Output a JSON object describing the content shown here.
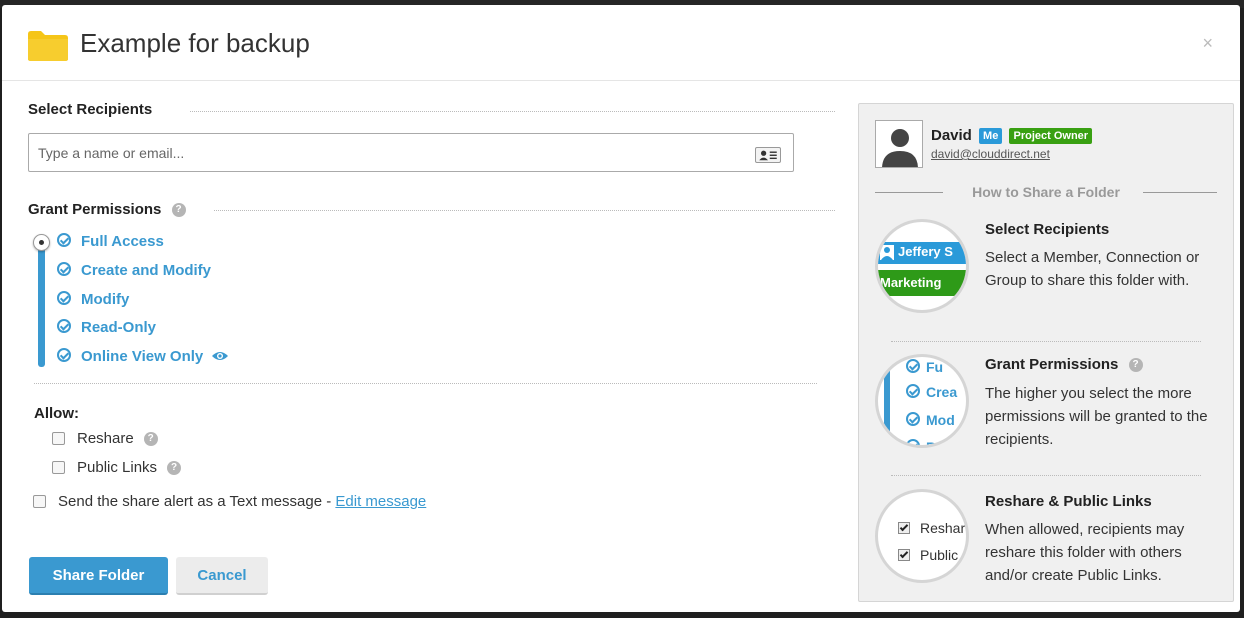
{
  "dialog": {
    "title": "Example for backup",
    "close_label": "×"
  },
  "recipients": {
    "section_title": "Select Recipients",
    "placeholder": "Type a name or email..."
  },
  "permissions": {
    "section_title": "Grant Permissions",
    "levels": [
      "Full Access",
      "Create and Modify",
      "Modify",
      "Read-Only",
      "Online View Only"
    ],
    "selected": "Full Access"
  },
  "allow": {
    "label": "Allow:",
    "reshare": "Reshare",
    "public_links": "Public Links"
  },
  "text_alert": {
    "label": "Send the share alert as a Text message - ",
    "edit_link": "Edit message"
  },
  "buttons": {
    "share": "Share Folder",
    "cancel": "Cancel"
  },
  "user": {
    "name": "David",
    "badge_me": "Me",
    "badge_role": "Project Owner",
    "email": "david@clouddirect.net"
  },
  "guide": {
    "title": "How to Share a Folder",
    "steps": [
      {
        "title": "Select Recipients",
        "desc": "Select a Member, Connection or Group to share this folder with.",
        "preview_top": "Jeffery S",
        "preview_bottom": "Marketing"
      },
      {
        "title": "Grant Permissions",
        "desc": "The higher you select the more permissions will be granted to the recipients.",
        "preview_items": [
          "Fu",
          "Crea",
          "Mod",
          "R"
        ]
      },
      {
        "title": "Reshare & Public Links",
        "desc": "When allowed, recipients may reshare this folder with others and/or create Public Links.",
        "preview_items": [
          "Reshar",
          "Public"
        ]
      }
    ]
  },
  "colors": {
    "accent": "#3a99d0",
    "badge_me": "#2a9ad9",
    "badge_owner": "#39a012",
    "folder": "#f5c518"
  }
}
